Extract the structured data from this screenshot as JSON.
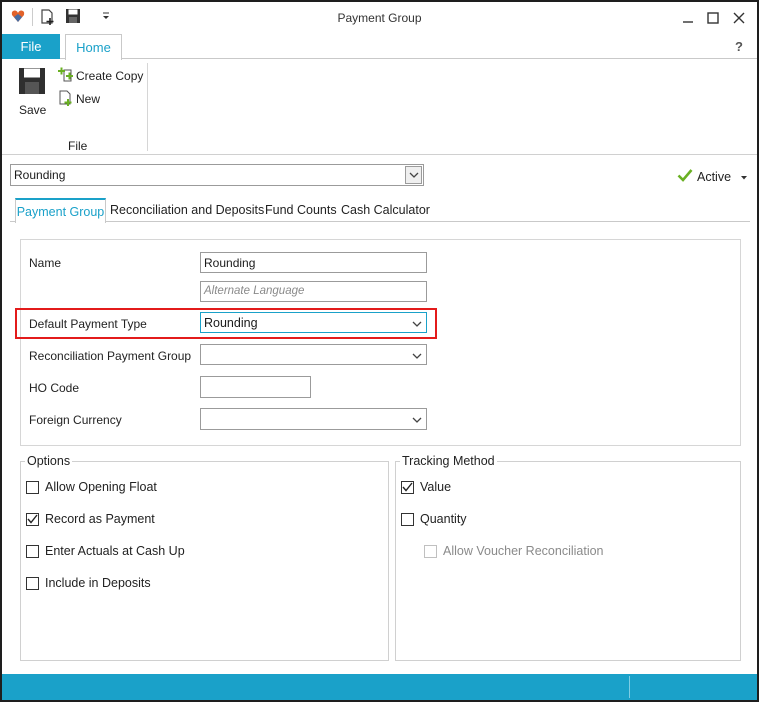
{
  "window": {
    "title": "Payment Group"
  },
  "ribbon": {
    "file_tab": "File",
    "home_tab": "Home",
    "help": "?",
    "save_label": "Save",
    "create_copy_label": "Create Copy",
    "new_label": "New",
    "group_label": "File"
  },
  "selector": {
    "value": "Rounding"
  },
  "status": {
    "label": "Active"
  },
  "tabs": [
    "Payment Group",
    "Reconciliation and Deposits",
    "Fund Counts",
    "Cash Calculator"
  ],
  "form": {
    "name_label": "Name",
    "name_value": "Rounding",
    "alt_placeholder": "Alternate Language",
    "default_payment_type_label": "Default Payment Type",
    "default_payment_type_value": "Rounding",
    "reconciliation_label": "Reconciliation Payment Group",
    "reconciliation_value": "",
    "ho_code_label": "HO Code",
    "ho_code_value": "",
    "foreign_currency_label": "Foreign Currency",
    "foreign_currency_value": ""
  },
  "options": {
    "title": "Options",
    "items": [
      {
        "label": "Allow Opening Float",
        "checked": false
      },
      {
        "label": "Record as Payment",
        "checked": true
      },
      {
        "label": "Enter Actuals at Cash Up",
        "checked": false
      },
      {
        "label": "Include in Deposits",
        "checked": false
      }
    ]
  },
  "tracking": {
    "title": "Tracking Method",
    "value_label": "Value",
    "value_checked": true,
    "quantity_label": "Quantity",
    "quantity_checked": false,
    "voucher_label": "Allow Voucher Reconciliation",
    "voucher_checked": false
  },
  "colors": {
    "accent": "#1aa1c9",
    "highlight": "#e31b1b",
    "check_green": "#6ab023"
  }
}
